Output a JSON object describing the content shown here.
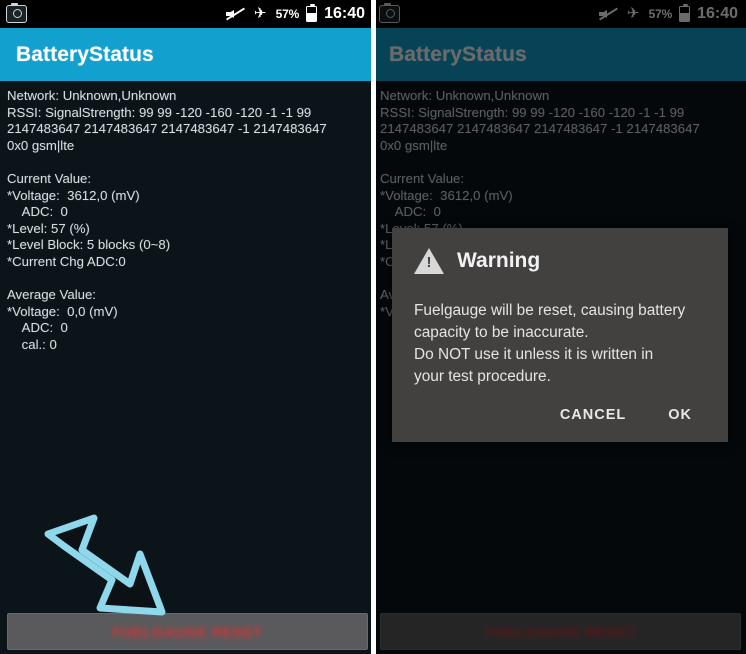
{
  "status_bar": {
    "camera_icon": "camera-icon",
    "mute_icon": "mute-icon",
    "airplane_icon": "airplane-mode-icon",
    "airplane_glyph": "✈",
    "battery_percent": "57%",
    "battery_icon": "battery-icon",
    "time": "16:40"
  },
  "app": {
    "title": "BatteryStatus",
    "accent_color": "#12a0cf",
    "background_color": "#0b1419"
  },
  "content": {
    "network_line": "Network: Unknown,Unknown",
    "rssi_line": "RSSI: SignalStrength: 99 99 -120 -160 -120 -1 -1 99",
    "rssi_line2": "2147483647 2147483647 2147483647 -1 2147483647",
    "rssi_line3": "0x0 gsm|lte",
    "current_value_header": "Current Value:",
    "current_voltage": "*Voltage:  3612,0 (mV)",
    "current_adc": "    ADC:  0",
    "current_level": "*Level: 57 (%)",
    "current_level_block": "*Level Block: 5 blocks (0~8)",
    "current_chg_adc": "*Current Chg ADC:0",
    "average_value_header": "Average Value:",
    "average_voltage": "*Voltage:  0,0 (mV)",
    "average_adc": "    ADC:  0",
    "average_cal": "    cal.: 0"
  },
  "reset_button": {
    "label": "FUELGAUGE RESET",
    "text_color": "#e03030",
    "background_color": "#5a5a5c"
  },
  "dialog": {
    "icon": "warning-triangle-icon",
    "title": "Warning",
    "message_line1": "Fuelgauge will be reset, causing battery",
    "message_line2": "capacity to be inaccurate.",
    "message_line3": "Do NOT use it unless it is written in",
    "message_line4": "your test procedure.",
    "cancel_label": "CANCEL",
    "ok_label": "OK",
    "background_color": "#434040"
  },
  "annotations": {
    "arrow_left": "down-right-arrow-annotation",
    "arrow_right": "up-arrow-annotation",
    "arrow_color": "#8fd8ec"
  }
}
